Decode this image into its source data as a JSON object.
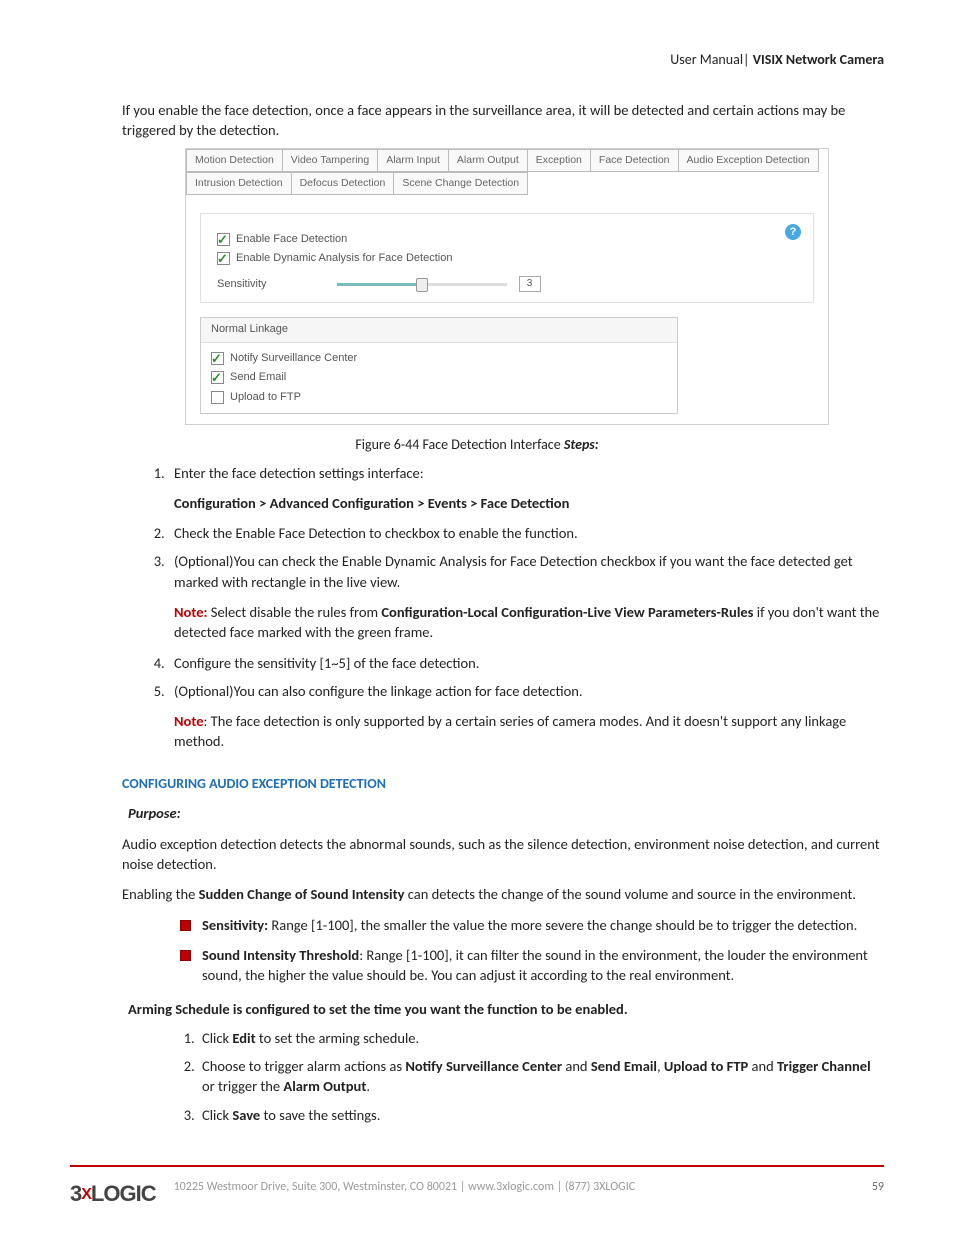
{
  "header": {
    "left": "User Manual|",
    "right": "VISIX Network Camera"
  },
  "intro": "If you enable the face detection, once a face appears in the surveillance area, it will be detected and certain actions may be triggered by the detection.",
  "figure": {
    "tabs_row1": [
      "Motion Detection",
      "Video Tampering",
      "Alarm Input",
      "Alarm Output",
      "Exception",
      "Face Detection",
      "Audio Exception Detection"
    ],
    "tabs_row2": [
      "Intrusion Detection",
      "Defocus Detection",
      "Scene Change Detection"
    ],
    "cb1": "Enable Face Detection",
    "cb2": "Enable Dynamic Analysis for Face Detection",
    "sens_label": "Sensitivity",
    "sens_value": "3",
    "linkage_head": "Normal Linkage",
    "link1": "Notify Surveillance Center",
    "link2": "Send Email",
    "link3": "Upload to FTP",
    "caption_prefix": "Figure 6-44 ",
    "caption_main": "Face Detection Interface ",
    "caption_steps": "Steps:"
  },
  "steps": {
    "s1": "Enter the face detection settings interface:",
    "s1_path": "Configuration > Advanced Configuration > Events > Face Detection",
    "s2": "Check the Enable Face Detection to checkbox to enable the function.",
    "s3": "(Optional)You can check the Enable Dynamic Analysis for Face Detection checkbox if you want the face detected get marked with rectangle in the live view.",
    "s3_note_label": "Note:",
    "s3_note_a": " Select disable the rules from ",
    "s3_note_b": "Configuration-Local Configuration-Live View Parameters-Rules",
    "s3_note_c": " if you don't want the detected face marked with the green frame.",
    "s4": "Configure the sensitivity [1~5] of the face detection.",
    "s5": "(Optional)You can also configure the linkage action for face detection.",
    "s5_note_label": "Note",
    "s5_note": ": The face detection is only supported by a certain series of camera modes. And it doesn't support any linkage method."
  },
  "section2": {
    "title": "CONFIGURING AUDIO EXCEPTION DETECTION",
    "purpose": "Purpose:",
    "p1": "Audio exception detection detects the abnormal sounds, such as the silence detection, environment noise detection, and current noise detection.",
    "p2a": "Enabling the ",
    "p2b": "Sudden Change of Sound Intensity",
    "p2c": " can detects the change of the sound volume and source in the environment.",
    "b1_label": "Sensitivity:",
    "b1": " Range [1-100], the smaller the value the more severe the change should be to trigger the detection.",
    "b2_label": "Sound Intensity Threshold",
    "b2": ": Range [1-100], it can filter the sound in the environment, the louder the environment sound, the higher the value should be. You can adjust it according to the real environment.",
    "arming": "Arming Schedule is configured to set the time you want the function to be enabled.",
    "a1a": "Click ",
    "a1b": "Edit",
    "a1c": " to set the arming schedule.",
    "a2a": "Choose to trigger alarm actions as ",
    "a2b": "Notify Surveillance Center",
    "a2c": " and ",
    "a2d": "Send Email",
    "a2e": ", ",
    "a2f": "Upload to FTP",
    "a2g": " and ",
    "a2h": "Trigger Channel",
    "a2i": " or trigger the ",
    "a2j": "Alarm Output",
    "a2k": ".",
    "a3a": "Click ",
    "a3b": "Save",
    "a3c": " to save the settings."
  },
  "footer": {
    "addr": "10225 Westmoor Drive, Suite 300, Westminster, CO 80021 | www.3xlogic.com | (877) 3XLOGIC",
    "page": "59"
  }
}
